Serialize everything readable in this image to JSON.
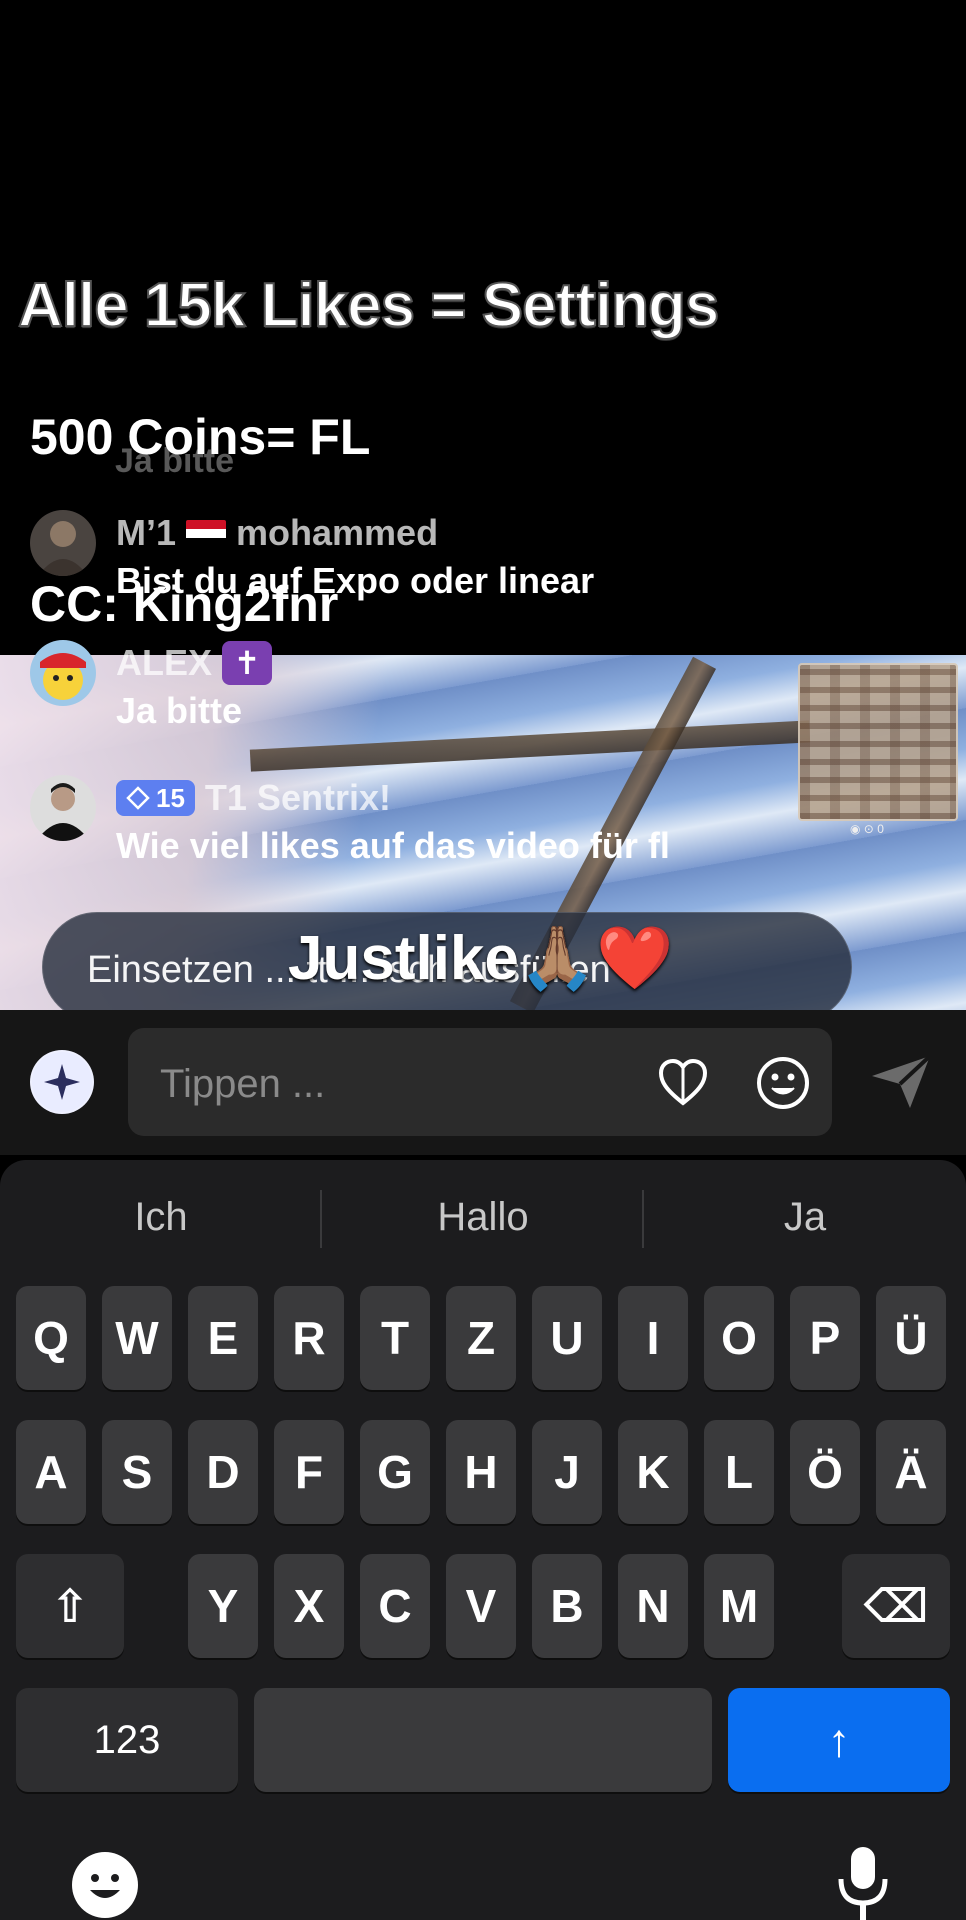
{
  "stream": {
    "overlay_title": "Alle 15k Likes = Settings",
    "overlay_coins": "500 Coins= FL",
    "overlay_cc": "CC: King2fnr",
    "faded_comment": "Ja bitte",
    "minimap_stats": "◉ ⊙ 0"
  },
  "comments": [
    {
      "name": "M’1",
      "name_suffix": "mohammed",
      "text": "Bist du auf Expo oder linear"
    },
    {
      "name": "ALEX",
      "badge": "✝",
      "text": "Ja bitte"
    },
    {
      "level": "15",
      "name": "T1 Sentrix!",
      "text": "Wie viel likes auf das video für fl"
    }
  ],
  "suggestion_pill": {
    "text": "Einsetzen ... tt ... isch ausfüllen",
    "overlay_text": "Justlike🙏🏽❤️"
  },
  "input": {
    "placeholder": "Tippen ..."
  },
  "keyboard": {
    "suggestions": [
      "Ich",
      "Hallo",
      "Ja"
    ],
    "row1": [
      "Q",
      "W",
      "E",
      "R",
      "T",
      "Z",
      "U",
      "I",
      "O",
      "P",
      "Ü"
    ],
    "row2": [
      "A",
      "S",
      "D",
      "F",
      "G",
      "H",
      "J",
      "K",
      "L",
      "Ö",
      "Ä"
    ],
    "row3": [
      "Y",
      "X",
      "C",
      "V",
      "B",
      "N",
      "M"
    ],
    "numbers_label": "123",
    "enter_glyph": "↑",
    "shift_glyph": "⇧",
    "delete_glyph": "⌫"
  }
}
